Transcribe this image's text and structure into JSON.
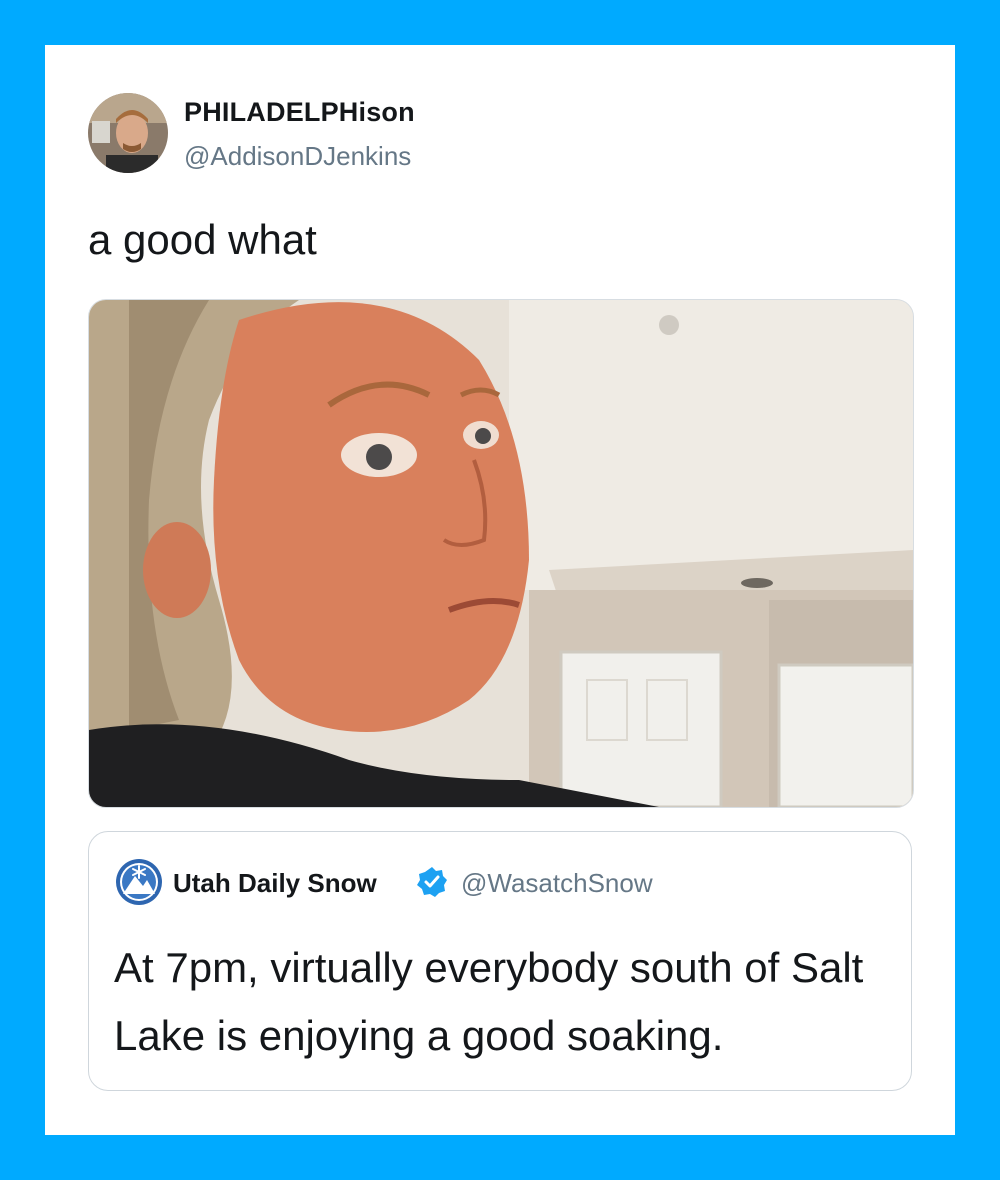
{
  "colors": {
    "background": "#00aaff",
    "card": "#ffffff",
    "text_primary": "#14171a",
    "text_secondary": "#657786",
    "verified": "#1da1f2"
  },
  "tweet": {
    "display_name": "PHILADELPHison",
    "handle": "@AddisonDJenkins",
    "text": "a good what",
    "avatar_icon": "profile-photo",
    "media_icon": "gif-reaction-photo"
  },
  "quoted_tweet": {
    "display_name": "Utah Daily Snow",
    "handle": "@WasatchSnow",
    "verified": true,
    "verified_icon": "verified-badge-icon",
    "logo_icon": "snowflake-mountain-logo",
    "text": "At 7pm, virtually everybody south of Salt Lake is enjoying a good soaking."
  }
}
